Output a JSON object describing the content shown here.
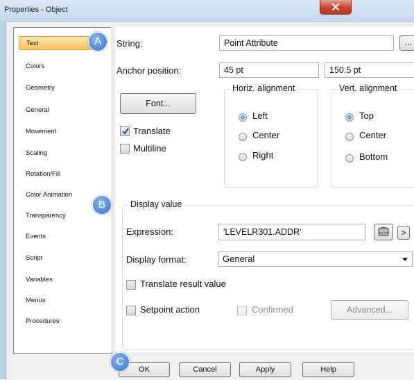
{
  "window": {
    "title": "Properties - Object"
  },
  "sidebar": {
    "items": [
      {
        "label": "Text",
        "selected": true
      },
      {
        "label": "Colors"
      },
      {
        "label": "Geometry"
      },
      {
        "label": "General"
      },
      {
        "label": "Movement"
      },
      {
        "label": "Scaling"
      },
      {
        "label": "Rotation/Fill"
      },
      {
        "label": "Color Animation"
      },
      {
        "label": "Transparency"
      },
      {
        "label": "Events"
      },
      {
        "label": "Script"
      },
      {
        "label": "Variables"
      },
      {
        "label": "Menus"
      },
      {
        "label": "Procedures"
      }
    ]
  },
  "text_panel": {
    "string_label": "String:",
    "string_value": "Point Attribute",
    "string_browse": "...",
    "anchor_label": "Anchor position:",
    "anchor_x": "45 pt",
    "anchor_y": "150.5 pt",
    "font_button": "Font...",
    "translate_label": "Translate",
    "translate_checked": true,
    "multiline_label": "Multiline",
    "multiline_checked": false,
    "horiz": {
      "title": "Horiz. alignment",
      "options": [
        "Left",
        "Center",
        "Right"
      ],
      "selected": "Left"
    },
    "vert": {
      "title": "Vert. alignment",
      "options": [
        "Top",
        "Center",
        "Bottom"
      ],
      "selected": "Top"
    }
  },
  "display_value": {
    "title": "Display value",
    "expression_label": "Expression:",
    "expression_value": "'LEVELR301.ADDR'",
    "next_label": ">",
    "format_label": "Display format:",
    "format_value": "General",
    "translate_result_label": "Translate result value",
    "setpoint_label": "Setpoint action",
    "confirmed_label": "Confirmed",
    "advanced_button": "Advanced..."
  },
  "footer": {
    "ok": "OK",
    "cancel": "Cancel",
    "apply": "Apply",
    "help": "Help"
  },
  "markers": {
    "a": "A",
    "b": "B",
    "c": "C"
  },
  "colors": {
    "selection": "#f8c45a",
    "marker": "#4f86d9",
    "close": "#c7432b"
  }
}
